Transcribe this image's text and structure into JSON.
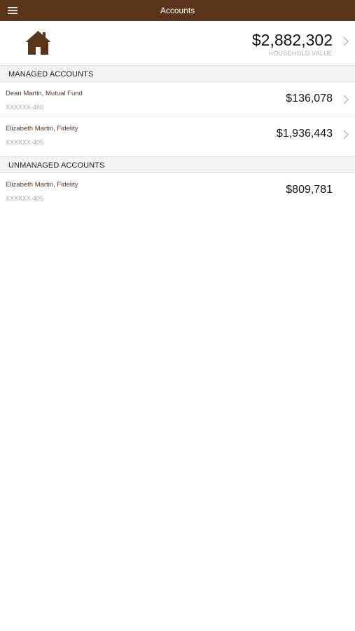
{
  "header": {
    "title": "Accounts",
    "menu_icon": "hamburger-menu-icon"
  },
  "household": {
    "icon": "house-icon",
    "value": "$2,882,302",
    "label": "HOUSEHOLD VALUE"
  },
  "managed": {
    "title": "MANAGED ACCOUNTS",
    "accounts": [
      {
        "name": "Dean Martin, Mutual Fund",
        "number": "XXXXXX-460",
        "value": "$136,078"
      },
      {
        "name": "Elizabeth Martin, Fidelity",
        "number": "XXXXXX-405",
        "value": "$1,936,443"
      }
    ]
  },
  "unmanaged": {
    "title": "UNMANAGED ACCOUNTS",
    "accounts": [
      {
        "name": "Elizabeth Martin, Fidelity",
        "number": "XXXXXX-405",
        "value": "$809,781"
      }
    ]
  },
  "colors": {
    "brand": "#5a3419",
    "section_background": "#f3f3f3",
    "muted_text": "#a8a8a8"
  }
}
